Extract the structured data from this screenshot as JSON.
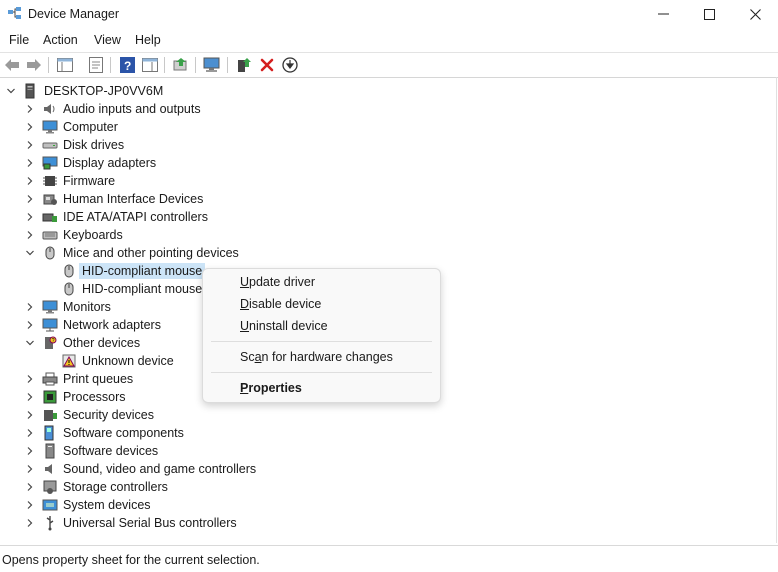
{
  "window": {
    "title": "Device Manager"
  },
  "menu": [
    "File",
    "Action",
    "View",
    "Help"
  ],
  "toolbar": {
    "buttons": [
      "back-icon",
      "forward-icon",
      "show-hide-console-tree-icon",
      "properties-sheet-icon",
      "help-icon",
      "action-pane-icon",
      "update-driver-icon",
      "scan-hardware-icon",
      "enable-device-icon",
      "uninstall-device-icon",
      "download-icon"
    ]
  },
  "tree": {
    "root": "DESKTOP-JP0VV6M",
    "categories": [
      "Audio inputs and outputs",
      "Computer",
      "Disk drives",
      "Display adapters",
      "Firmware",
      "Human Interface Devices",
      "IDE ATA/ATAPI controllers",
      "Keyboards",
      "Mice and other pointing devices",
      "Monitors",
      "Network adapters",
      "Other devices",
      "Print queues",
      "Processors",
      "Security devices",
      "Software components",
      "Software devices",
      "Sound, video and game controllers",
      "Storage controllers",
      "System devices",
      "Universal Serial Bus controllers"
    ],
    "mice_children": [
      "HID-compliant mouse",
      "HID-compliant mouse"
    ],
    "other_children": [
      "Unknown device"
    ]
  },
  "context_menu": {
    "update": {
      "pre": "",
      "acc": "U",
      "post": "pdate driver"
    },
    "disable": {
      "pre": "",
      "acc": "D",
      "post": "isable device"
    },
    "uninstall": {
      "pre": "",
      "acc": "U",
      "post": "ninstall device"
    },
    "scan": {
      "pre": "Sc",
      "acc": "a",
      "post": "n for hardware changes"
    },
    "properties": {
      "pre": "",
      "acc": "P",
      "post": "roperties"
    }
  },
  "status": {
    "text": "Opens property sheet for the current selection."
  },
  "colors": {
    "selection": "#cce4f7",
    "accent": "#1f6fc5"
  }
}
